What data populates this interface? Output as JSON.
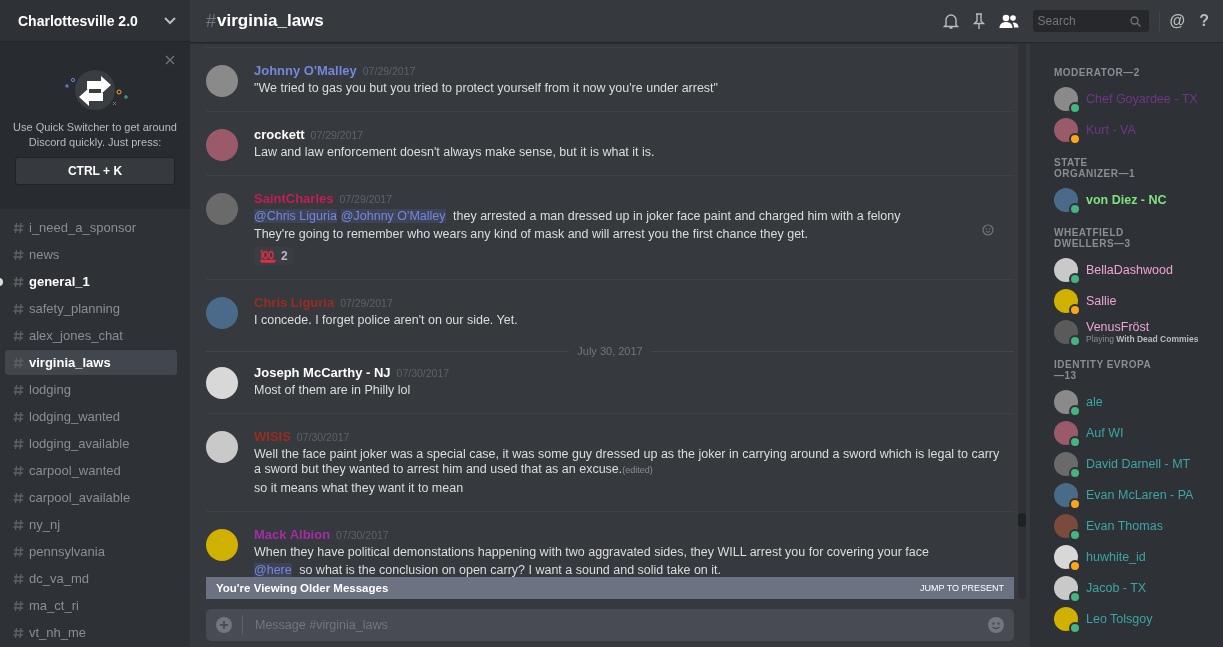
{
  "server": {
    "name": "Charlottesville 2.0"
  },
  "quick_switcher": {
    "text": "Use Quick Switcher to get around Discord quickly. Just press:",
    "shortcut": "CTRL + K"
  },
  "channels": [
    {
      "name": "i_need_a_sponsor",
      "unread": false,
      "selected": false
    },
    {
      "name": "news",
      "unread": false,
      "selected": false
    },
    {
      "name": "general_1",
      "unread": true,
      "selected": false
    },
    {
      "name": "safety_planning",
      "unread": false,
      "selected": false
    },
    {
      "name": "alex_jones_chat",
      "unread": false,
      "selected": false
    },
    {
      "name": "virginia_laws",
      "unread": false,
      "selected": true
    },
    {
      "name": "lodging",
      "unread": false,
      "selected": false
    },
    {
      "name": "lodging_wanted",
      "unread": false,
      "selected": false
    },
    {
      "name": "lodging_available",
      "unread": false,
      "selected": false
    },
    {
      "name": "carpool_wanted",
      "unread": false,
      "selected": false
    },
    {
      "name": "carpool_available",
      "unread": false,
      "selected": false
    },
    {
      "name": "ny_nj",
      "unread": false,
      "selected": false
    },
    {
      "name": "pennsylvania",
      "unread": false,
      "selected": false
    },
    {
      "name": "dc_va_md",
      "unread": false,
      "selected": false
    },
    {
      "name": "ma_ct_ri",
      "unread": false,
      "selected": false
    },
    {
      "name": "vt_nh_me",
      "unread": false,
      "selected": false
    }
  ],
  "header": {
    "hash": "#",
    "channel": "virginia_laws",
    "search_placeholder": "Search",
    "text_buttons": [
      "@",
      "?"
    ]
  },
  "messages": [
    {
      "kind": "message",
      "author": "Johnny O'Malley",
      "color": "#7289da",
      "time": "07/29/2017",
      "paragraphs": [
        [
          {
            "kind": "text",
            "text": "\"We tried to gas you but you tried to protect yourself from it now you're under arrest\""
          }
        ]
      ]
    },
    {
      "kind": "message",
      "author": "crockett",
      "color": "#ffffff",
      "time": "07/29/2017",
      "paragraphs": [
        [
          {
            "kind": "text",
            "text": "Law and law enforcement doesn't always make sense, but it is what it is."
          }
        ]
      ]
    },
    {
      "kind": "message",
      "author": "SaintCharles",
      "color": "#c21e56",
      "time": "07/29/2017",
      "hover": true,
      "paragraphs": [
        [
          {
            "kind": "mention",
            "text": "@Chris Liguria"
          },
          {
            "kind": "mention",
            "text": "@Johnny O'Malley"
          },
          {
            "kind": "text",
            "text": " they arrested a man dressed up in joker face paint and charged him with a felony"
          }
        ],
        [
          {
            "kind": "text",
            "text": "They're going to remember who wears any kind of mask and will arrest you the first chance they get."
          }
        ]
      ],
      "reaction": {
        "count": "2"
      }
    },
    {
      "kind": "message",
      "author": "Chris Liguria",
      "color": "#992d22",
      "time": "07/29/2017",
      "paragraphs": [
        [
          {
            "kind": "text",
            "text": "I concede. I forget police aren't on our side. Yet."
          }
        ]
      ]
    },
    {
      "kind": "divider",
      "text": "July 30, 2017"
    },
    {
      "kind": "message",
      "author": "Joseph McCarthy - NJ",
      "color": "#ffffff",
      "time": "07/30/2017",
      "paragraphs": [
        [
          {
            "kind": "text",
            "text": "Most of them are in Philly lol"
          }
        ]
      ]
    },
    {
      "kind": "message",
      "author": "WISIS",
      "color": "#992d22",
      "time": "07/30/2017",
      "paragraphs": [
        [
          {
            "kind": "text",
            "text": "Well the face paint joker was a special case, it was some guy dressed up as the joker in carrying around a sword which is legal to carry a sword but they wanted to arrest him and used that as an excuse."
          },
          {
            "kind": "edited",
            "text": "(edited)"
          }
        ],
        [
          {
            "kind": "text",
            "text": "so it means what they want it to mean"
          }
        ]
      ]
    },
    {
      "kind": "message",
      "author": "Mack Albion",
      "color": "#a62ca6",
      "time": "07/30/2017",
      "paragraphs": [
        [
          {
            "kind": "text",
            "text": "When they have political demonstations happening with two aggravated sides, they WILL arrest you for covering your face"
          }
        ],
        [
          {
            "kind": "mention",
            "text": "@here"
          },
          {
            "kind": "text",
            "text": " so what is the conclusion on open carry? I want a sound and solid take on it."
          }
        ]
      ]
    }
  ],
  "older_banner": {
    "text": "You're Viewing Older Messages",
    "action": "JUMP TO PRESENT"
  },
  "composer": {
    "placeholder": "Message #virginia_laws"
  },
  "member_groups": [
    {
      "title": "MODERATOR—2",
      "members": [
        {
          "name": "Chef Goyardee - TX",
          "color": "#71368a",
          "idle": false,
          "bold": false
        },
        {
          "name": "Kurt - VA",
          "color": "#71368a",
          "idle": true,
          "bold": false
        }
      ]
    },
    {
      "title": "STATE ORGANIZER—1",
      "members": [
        {
          "name": "von Diez - NC",
          "color": "#7ee27e",
          "idle": false,
          "bold": true
        }
      ]
    },
    {
      "title": "WHEATFIELD DWELLERS—3",
      "members": [
        {
          "name": "BellaDashwood",
          "color": "#f1a3d6",
          "idle": false,
          "bold": false
        },
        {
          "name": "Sallie",
          "color": "#f1a3d6",
          "idle": true,
          "bold": false
        },
        {
          "name": "VenusFröst",
          "color": "#f1a3d6",
          "idle": false,
          "bold": false,
          "activity": "Playing",
          "game": "With Dead Commies"
        }
      ]
    },
    {
      "title": "IDENTITY EVROPA—13",
      "members": [
        {
          "name": "ale",
          "color": "#3aa6a6",
          "idle": false,
          "bold": false
        },
        {
          "name": "Auf WI",
          "color": "#3aa6a6",
          "idle": false,
          "bold": false
        },
        {
          "name": "David Darnell - MT",
          "color": "#3aa6a6",
          "idle": false,
          "bold": false
        },
        {
          "name": "Evan McLaren - PA",
          "color": "#3aa6a6",
          "idle": true,
          "bold": false
        },
        {
          "name": "Evan Thomas",
          "color": "#3aa6a6",
          "idle": false,
          "bold": false
        },
        {
          "name": "huwhite_id",
          "color": "#3aa6a6",
          "idle": true,
          "bold": false
        },
        {
          "name": "Jacob - TX",
          "color": "#3aa6a6",
          "idle": false,
          "bold": false
        },
        {
          "name": "Leo Tolsgoy",
          "color": "#3aa6a6",
          "idle": false,
          "bold": false
        }
      ]
    }
  ]
}
